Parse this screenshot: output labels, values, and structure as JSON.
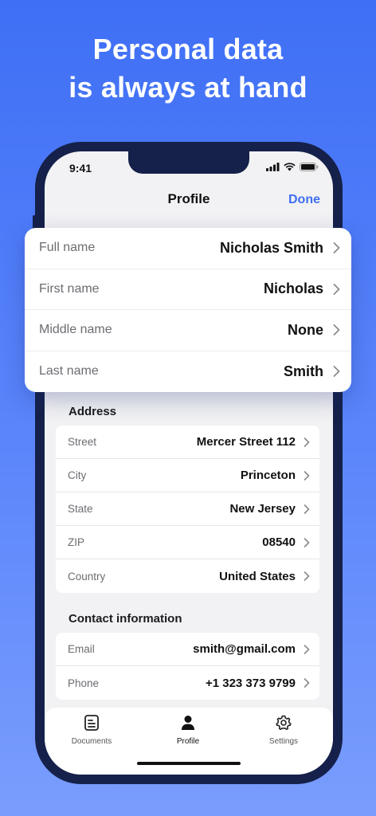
{
  "headline": {
    "line1": "Personal data",
    "line2": "is always at hand"
  },
  "status_bar": {
    "time": "9:41"
  },
  "nav": {
    "title": "Profile",
    "done_label": "Done"
  },
  "name_card": {
    "rows": [
      {
        "label": "Full name",
        "value": "Nicholas Smith"
      },
      {
        "label": "First name",
        "value": "Nicholas"
      },
      {
        "label": "Middle name",
        "value": "None"
      },
      {
        "label": "Last name",
        "value": "Smith"
      }
    ]
  },
  "address": {
    "title": "Address",
    "rows": [
      {
        "label": "Street",
        "value": "Mercer Street 112"
      },
      {
        "label": "City",
        "value": "Princeton"
      },
      {
        "label": "State",
        "value": "New Jersey"
      },
      {
        "label": "ZIP",
        "value": "08540"
      },
      {
        "label": "Country",
        "value": "United States"
      }
    ]
  },
  "contact": {
    "title": "Contact information",
    "rows": [
      {
        "label": "Email",
        "value": "smith@gmail.com"
      },
      {
        "label": "Phone",
        "value": "+1 323 373 9799"
      }
    ]
  },
  "tabbar": {
    "items": [
      {
        "label": "Documents",
        "icon": "document-icon"
      },
      {
        "label": "Profile",
        "icon": "person-icon",
        "active": true
      },
      {
        "label": "Settings",
        "icon": "gear-icon"
      }
    ]
  },
  "colors": {
    "accent": "#3d6ff0",
    "background_top": "#3f6ff5",
    "phone_frame": "#15214a"
  }
}
